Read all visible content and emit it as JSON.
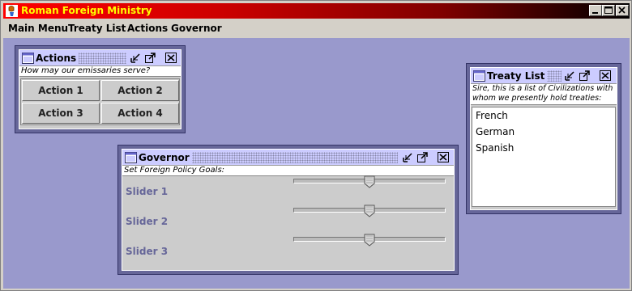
{
  "app": {
    "title": "Roman Foreign Ministry"
  },
  "menubar": {
    "items": [
      "Main Menu",
      "Treaty List",
      "Actions",
      "Governor"
    ]
  },
  "actions_window": {
    "title": "Actions",
    "prompt": "How may our emissaries serve?",
    "buttons": [
      "Action 1",
      "Action 2",
      "Action 3",
      "Action 4"
    ]
  },
  "treaty_window": {
    "title": "Treaty List",
    "prompt_line1": "Sire, this is a list of Civilizations with",
    "prompt_line2": "whom we presently hold treaties:",
    "items": [
      "French",
      "German",
      "Spanish"
    ]
  },
  "governor_window": {
    "title": "Governor",
    "prompt": "Set Foreign Policy Goals:",
    "sliders": [
      {
        "label": "Slider 1",
        "value": 0.5
      },
      {
        "label": "Slider 2",
        "value": 0.5
      },
      {
        "label": "Slider 3",
        "value": 0.5
      }
    ]
  },
  "colors": {
    "title_start": "#ff0000",
    "title_end": "#000000",
    "title_text": "#ffff00",
    "desktop": "#9999cc",
    "frame_title": "#ccccff",
    "slider_label": "#666699"
  },
  "icons": [
    "app-icon",
    "window-icon",
    "minimize-icon",
    "maximize-icon",
    "close-icon",
    "iconify-icon"
  ]
}
